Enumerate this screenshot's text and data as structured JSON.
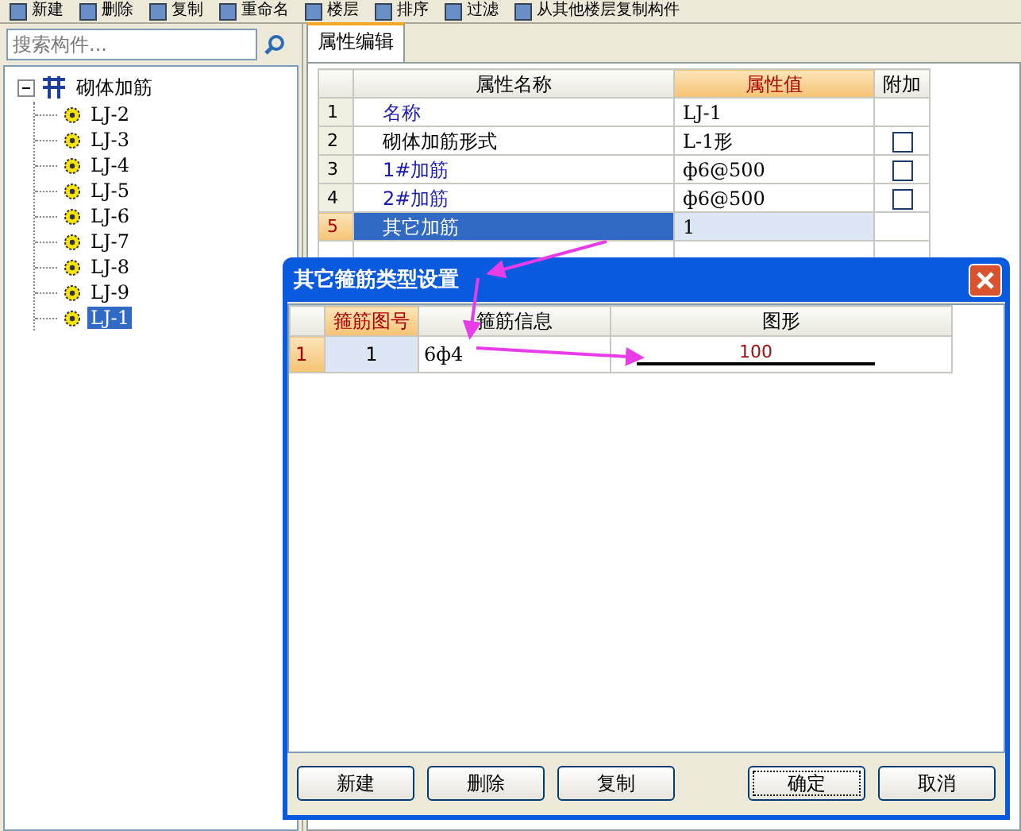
{
  "toolbar": {
    "items": [
      {
        "label": "新建"
      },
      {
        "label": "删除"
      },
      {
        "label": "复制"
      },
      {
        "label": "重命名"
      },
      {
        "label": "楼层"
      },
      {
        "label": "排序"
      },
      {
        "label": "过滤"
      },
      {
        "label": "从其他楼层复制构件"
      }
    ]
  },
  "search": {
    "placeholder": "搜索构件..."
  },
  "tree": {
    "label": "砌体加筋",
    "expanded": true,
    "children": [
      {
        "label": "LJ-2",
        "selected": false
      },
      {
        "label": "LJ-3",
        "selected": false
      },
      {
        "label": "LJ-4",
        "selected": false
      },
      {
        "label": "LJ-5",
        "selected": false
      },
      {
        "label": "LJ-6",
        "selected": false
      },
      {
        "label": "LJ-7",
        "selected": false
      },
      {
        "label": "LJ-8",
        "selected": false
      },
      {
        "label": "LJ-9",
        "selected": false
      },
      {
        "label": "LJ-1",
        "selected": true
      }
    ]
  },
  "tabs": [
    {
      "label": "属性编辑",
      "selected": true
    }
  ],
  "property_grid": {
    "columns": [
      "属性名称",
      "属性值",
      "附加"
    ],
    "rows": [
      {
        "index": "1",
        "name": "名称",
        "value": "LJ-1",
        "kind": "public",
        "selected": false
      },
      {
        "index": "2",
        "name": "砌体加筋形式",
        "value": "L-1形",
        "kind": "private",
        "selected": false,
        "checkbox": {
          "checked": false
        }
      },
      {
        "index": "3",
        "name": "1#加筋",
        "value": "ф6@500",
        "kind": "public",
        "selected": false,
        "checkbox": {
          "checked": false
        }
      },
      {
        "index": "4",
        "name": "2#加筋",
        "value": "ф6@500",
        "kind": "public",
        "selected": false,
        "checkbox": {
          "checked": false
        }
      },
      {
        "index": "5",
        "name": "其它加筋",
        "value": "1",
        "kind": "private",
        "selected": true
      }
    ]
  },
  "dialog": {
    "title": "其它箍筋类型设置",
    "columns": [
      "箍筋图号",
      "箍筋信息",
      "图形"
    ],
    "rows": [
      {
        "index": "1",
        "number": "1",
        "info": "6ф4",
        "shape_label": "100",
        "selected": true
      }
    ],
    "buttons": [
      {
        "label": "新建",
        "focused": false
      },
      {
        "label": "删除",
        "focused": false
      },
      {
        "label": "复制",
        "focused": false
      },
      {
        "label": "确定",
        "focused": true
      },
      {
        "label": "取消",
        "focused": false
      }
    ]
  }
}
